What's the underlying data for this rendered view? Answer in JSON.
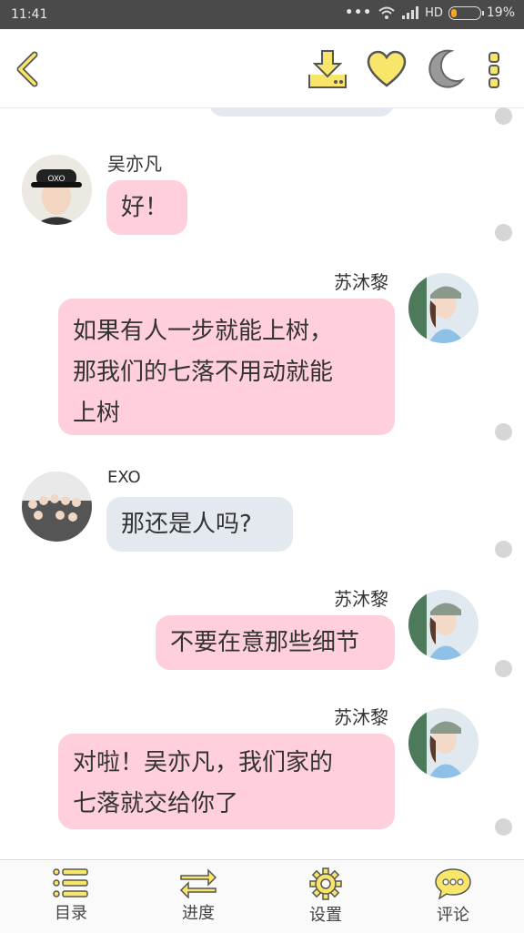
{
  "status_bar": {
    "time": "11:41",
    "network": "HD",
    "battery": "19%",
    "battery_level": 0.19
  },
  "toolbar": {
    "icons": [
      "back-icon",
      "download-icon",
      "heart-icon",
      "moon-icon",
      "more-vertical-icon"
    ]
  },
  "messages": [
    {
      "sender": "吴亦凡",
      "text": "好！",
      "side": "left",
      "style": "pink",
      "avatar_label": "OXO"
    },
    {
      "sender": "苏沐黎",
      "lines": [
        "如果有人一步就能上树，",
        "那我们的七落不用动就能",
        "上树"
      ],
      "side": "right",
      "style": "pink"
    },
    {
      "sender": "EXO",
      "text": "那还是人吗?",
      "side": "left",
      "style": "grey"
    },
    {
      "sender": "苏沐黎",
      "text": "不要在意那些细节",
      "side": "right",
      "style": "pink"
    },
    {
      "sender": "苏沐黎",
      "lines": [
        "对啦！吴亦凡，我们家的",
        "七落就交给你了"
      ],
      "side": "right",
      "style": "pink"
    }
  ],
  "bottom_nav": [
    {
      "label": "目录",
      "icon": "list-icon"
    },
    {
      "label": "进度",
      "icon": "swap-icon"
    },
    {
      "label": "设置",
      "icon": "gear-icon"
    },
    {
      "label": "评论",
      "icon": "comment-icon"
    }
  ],
  "colors": {
    "accent_yellow": "#f8e66a",
    "icon_outline": "#555555",
    "bubble_pink": "#ffcfdb",
    "bubble_grey": "#e4e9f0"
  }
}
